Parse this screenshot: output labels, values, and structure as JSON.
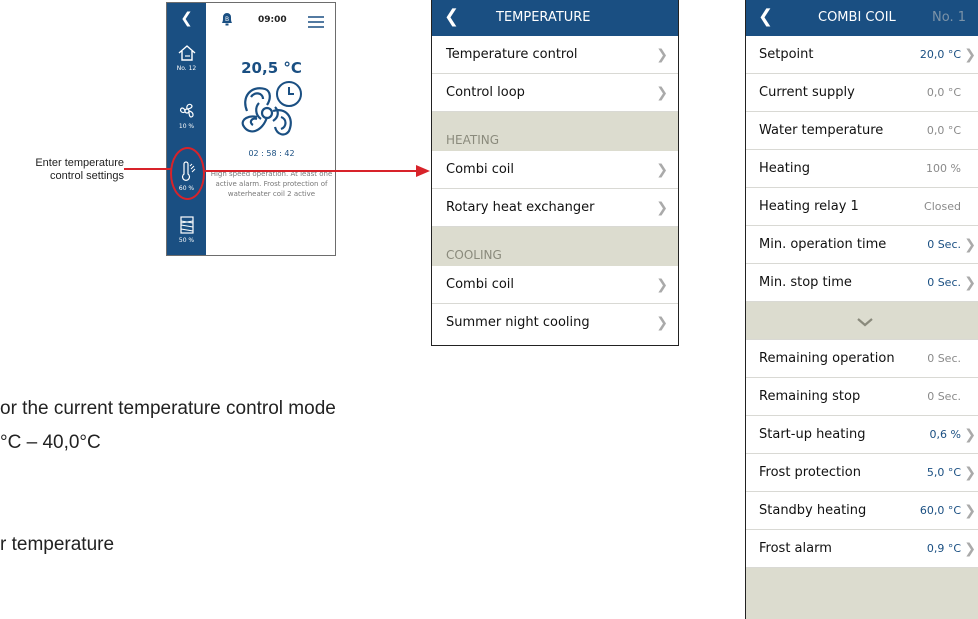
{
  "phone": {
    "time": "09:00",
    "temperature": "20,5 °C",
    "timer": "02 : 58 : 42",
    "status_text": "High speed operation. At least one active alarm. Frost protection of waterheater coil 2 active",
    "sidebar": {
      "back_icon": "chevron-left-icon",
      "items": [
        {
          "icon": "home-icon",
          "label": "No. 12"
        },
        {
          "icon": "fan-icon",
          "label": "10 %"
        },
        {
          "icon": "thermometer-icon",
          "label": "60 %"
        },
        {
          "icon": "heat-exchanger-icon",
          "label": "50 %"
        }
      ]
    },
    "bell_badge": "B"
  },
  "callout": {
    "text": "Enter temperature control settings",
    "color": "#d8232a"
  },
  "temperature_panel": {
    "title": "TEMPERATURE",
    "rows_top": [
      "Temperature control",
      "Control loop"
    ],
    "heating_section": "HEATING",
    "heating_rows": [
      "Combi coil",
      "Rotary heat exchanger"
    ],
    "cooling_section": "COOLING",
    "cooling_rows": [
      "Combi coil",
      "Summer night cooling"
    ]
  },
  "combi_panel": {
    "title": "COMBI COIL",
    "subtitle": "No. 1",
    "rows": [
      {
        "label": "Setpoint",
        "value": "20,0 °C",
        "editable": true
      },
      {
        "label": "Current supply",
        "value": "0,0 °C",
        "editable": false
      },
      {
        "label": "Water temperature",
        "value": "0,0 °C",
        "editable": false
      },
      {
        "label": "Heating",
        "value": "100 %",
        "editable": false
      },
      {
        "label": "Heating relay 1",
        "value": "Closed",
        "editable": false
      },
      {
        "label": "Min. operation time",
        "value": "0 Sec.",
        "editable": true
      },
      {
        "label": "Min. stop time",
        "value": "0 Sec.",
        "editable": true
      }
    ],
    "expand_icon": "chevron-down-icon",
    "rows_more": [
      {
        "label": "Remaining operation",
        "value": "0 Sec.",
        "editable": false
      },
      {
        "label": "Remaining stop",
        "value": "0 Sec.",
        "editable": false
      },
      {
        "label": "Start-up heating",
        "value": "0,6 %",
        "editable": true
      },
      {
        "label": "Frost protection",
        "value": "5,0 °C",
        "editable": true
      },
      {
        "label": "Standby heating",
        "value": "60,0 °C",
        "editable": true
      },
      {
        "label": "Frost alarm",
        "value": "0,9 °C",
        "editable": true
      }
    ]
  },
  "body_text": {
    "line1": "or the current temperature control mode",
    "line2": "°C – 40,0°C",
    "line3": "r temperature"
  },
  "colors": {
    "brand_blue": "#1a4f82",
    "section_bg": "#dcdccf",
    "arrow_red": "#d8232a"
  }
}
